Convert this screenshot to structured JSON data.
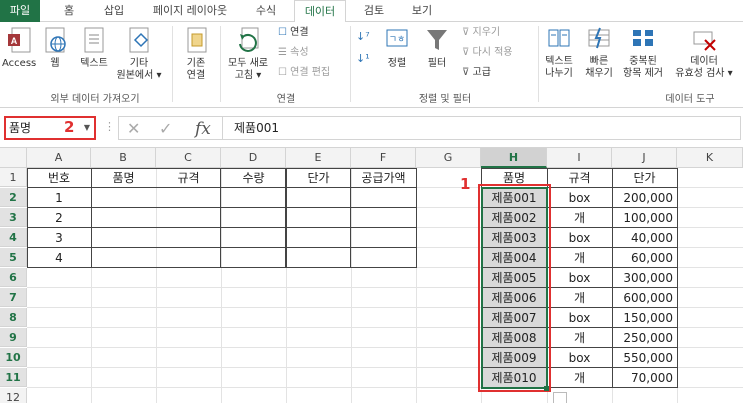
{
  "tabs": [
    "파일",
    "홈",
    "삽입",
    "페이지 레이아웃",
    "수식",
    "데이터",
    "검토",
    "보기"
  ],
  "active_tab": "데이터",
  "ribbon": {
    "external_group": {
      "label": "외부 데이터 가져오기",
      "access": "Access",
      "web": "웹",
      "text": "텍스트",
      "other_line1": "기타",
      "other_line2": "원본에서 ▾"
    },
    "existing": {
      "line1": "기존",
      "line2": "연결"
    },
    "connections_group": {
      "label": "연결",
      "refresh_line1": "모두 새로",
      "refresh_line2": "고침 ▾",
      "connections": "연결",
      "properties": "속성",
      "edit_links": "연결 편집"
    },
    "sort_group": {
      "label": "정렬 및 필터",
      "sort": "정렬",
      "filter": "필터",
      "clear": "지우기",
      "reapply": "다시 적용",
      "advanced": "고급"
    },
    "tools_group": {
      "label": "데이터 도구",
      "text_cols_line1": "텍스트",
      "text_cols_line2": "나누기",
      "flash_line1": "빠른",
      "flash_line2": "채우기",
      "dup_line1": "중복된",
      "dup_line2": "항목 제거",
      "valid_line1": "데이터",
      "valid_line2": "유효성 검사 ▾"
    }
  },
  "formula_bar": {
    "name_box": "품명",
    "annotation_2": "2",
    "value": "제품001"
  },
  "columns": [
    "A",
    "B",
    "C",
    "D",
    "E",
    "F",
    "G",
    "H",
    "I",
    "J",
    "K"
  ],
  "rows": [
    "1",
    "2",
    "3",
    "4",
    "5",
    "6",
    "7",
    "8",
    "9",
    "10",
    "11",
    "12"
  ],
  "left_table": {
    "headers": [
      "번호",
      "품명",
      "규격",
      "수량",
      "단가",
      "공급가액"
    ],
    "numbers": [
      "1",
      "2",
      "3",
      "4"
    ]
  },
  "right_table": {
    "headers": [
      "품명",
      "규격",
      "단가"
    ],
    "rows": [
      [
        "제품001",
        "box",
        "200,000"
      ],
      [
        "제품002",
        "개",
        "100,000"
      ],
      [
        "제품003",
        "box",
        "40,000"
      ],
      [
        "제품004",
        "개",
        "60,000"
      ],
      [
        "제품005",
        "box",
        "300,000"
      ],
      [
        "제품006",
        "개",
        "600,000"
      ],
      [
        "제품007",
        "box",
        "150,000"
      ],
      [
        "제품008",
        "개",
        "250,000"
      ],
      [
        "제품009",
        "box",
        "550,000"
      ],
      [
        "제품010",
        "개",
        "70,000"
      ]
    ]
  },
  "annotation_1": "1",
  "colors": {
    "accent": "#217346",
    "annotation": "#e03030"
  }
}
